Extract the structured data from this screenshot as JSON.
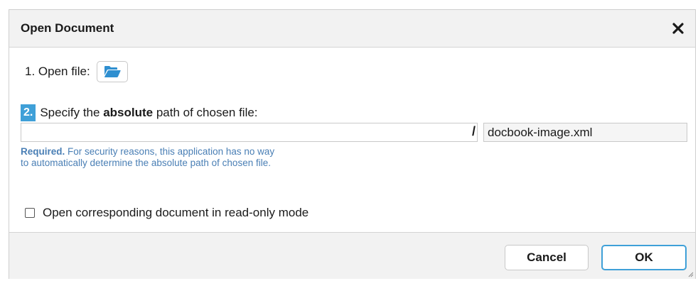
{
  "dialog": {
    "title": "Open Document",
    "close_icon": "close-icon"
  },
  "step1": {
    "label": "1. Open file:",
    "button_icon": "folder-open-icon"
  },
  "step2": {
    "number": "2.",
    "label_before": "Specify the",
    "label_bold": "absolute",
    "label_after": "path of chosen file:",
    "path_value": "",
    "path_placeholder": "",
    "separator": "/",
    "filename": "docbook-image.xml"
  },
  "help": {
    "required": "Required.",
    "line1": "For security reasons, this application has no way",
    "line2": "to automatically determine the absolute path of chosen file."
  },
  "readonly_option": {
    "label": "Open corresponding document in read-only mode",
    "checked": false
  },
  "buttons": {
    "cancel": "Cancel",
    "ok": "OK"
  },
  "colors": {
    "accent": "#3fa0d8",
    "help_text": "#4a7fb5",
    "bar_bg": "#f2f2f2"
  }
}
